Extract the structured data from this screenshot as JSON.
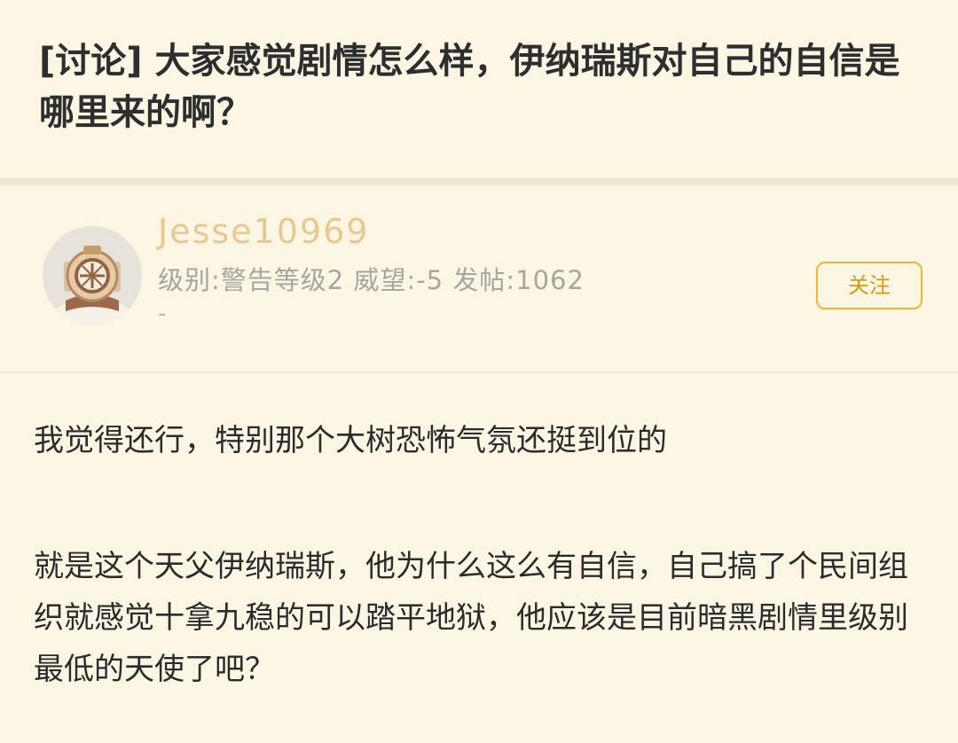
{
  "thread": {
    "title": "[讨论] 大家感觉剧情怎么样，伊纳瑞斯对自己的自信是哪里来的啊？"
  },
  "author": {
    "username": "Jesse10969",
    "meta": "级别:警告等级2 威望:-5 发帖:1062",
    "extra": "-",
    "follow_label": "关注"
  },
  "post": {
    "paragraphs": [
      "我觉得还行，特别那个大树恐怖气氛还挺到位的",
      "就是这个天父伊纳瑞斯，他为什么这么有自信，自己搞了个民间组织就感觉十拿九稳的可以踏平地狱，他应该是目前暗黑剧情里级别最低的天使了吧？"
    ]
  },
  "colors": {
    "background": "#fbf6e3",
    "username": "#e7c891",
    "follow_border": "#e9b83a",
    "follow_text": "#d39a12",
    "divider": "#ece6d2"
  }
}
